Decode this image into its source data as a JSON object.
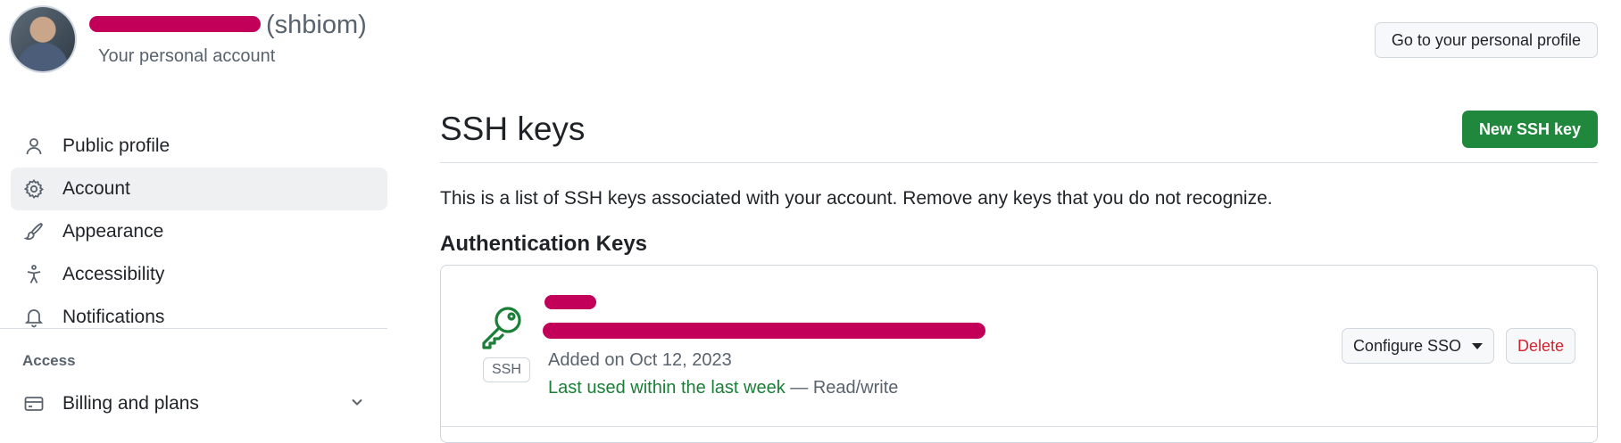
{
  "header": {
    "username_handle": "(shbiom)",
    "subtitle": "Your personal account",
    "profile_button": "Go to your personal profile"
  },
  "sidebar": {
    "items": [
      {
        "label": "Public profile",
        "icon": "person-icon",
        "active": false
      },
      {
        "label": "Account",
        "icon": "gear-icon",
        "active": true
      },
      {
        "label": "Appearance",
        "icon": "paintbrush-icon",
        "active": false
      },
      {
        "label": "Accessibility",
        "icon": "accessibility-icon",
        "active": false
      },
      {
        "label": "Notifications",
        "icon": "bell-icon",
        "active": false
      }
    ],
    "access_heading": "Access",
    "billing_label": "Billing and plans"
  },
  "main": {
    "title": "SSH keys",
    "new_key_button": "New SSH key",
    "intro": "This is a list of SSH keys associated with your account. Remove any keys that you do not recognize.",
    "section_heading": "Authentication Keys",
    "key": {
      "badge": "SSH",
      "added": "Added on Oct 12, 2023",
      "last_used": "Last used within the last week",
      "access": " — Read/write",
      "configure_button": "Configure SSO",
      "delete_button": "Delete"
    }
  },
  "colors": {
    "primary_green": "#1f883d",
    "danger_red": "#d1242f",
    "redaction": "#c2005a"
  }
}
